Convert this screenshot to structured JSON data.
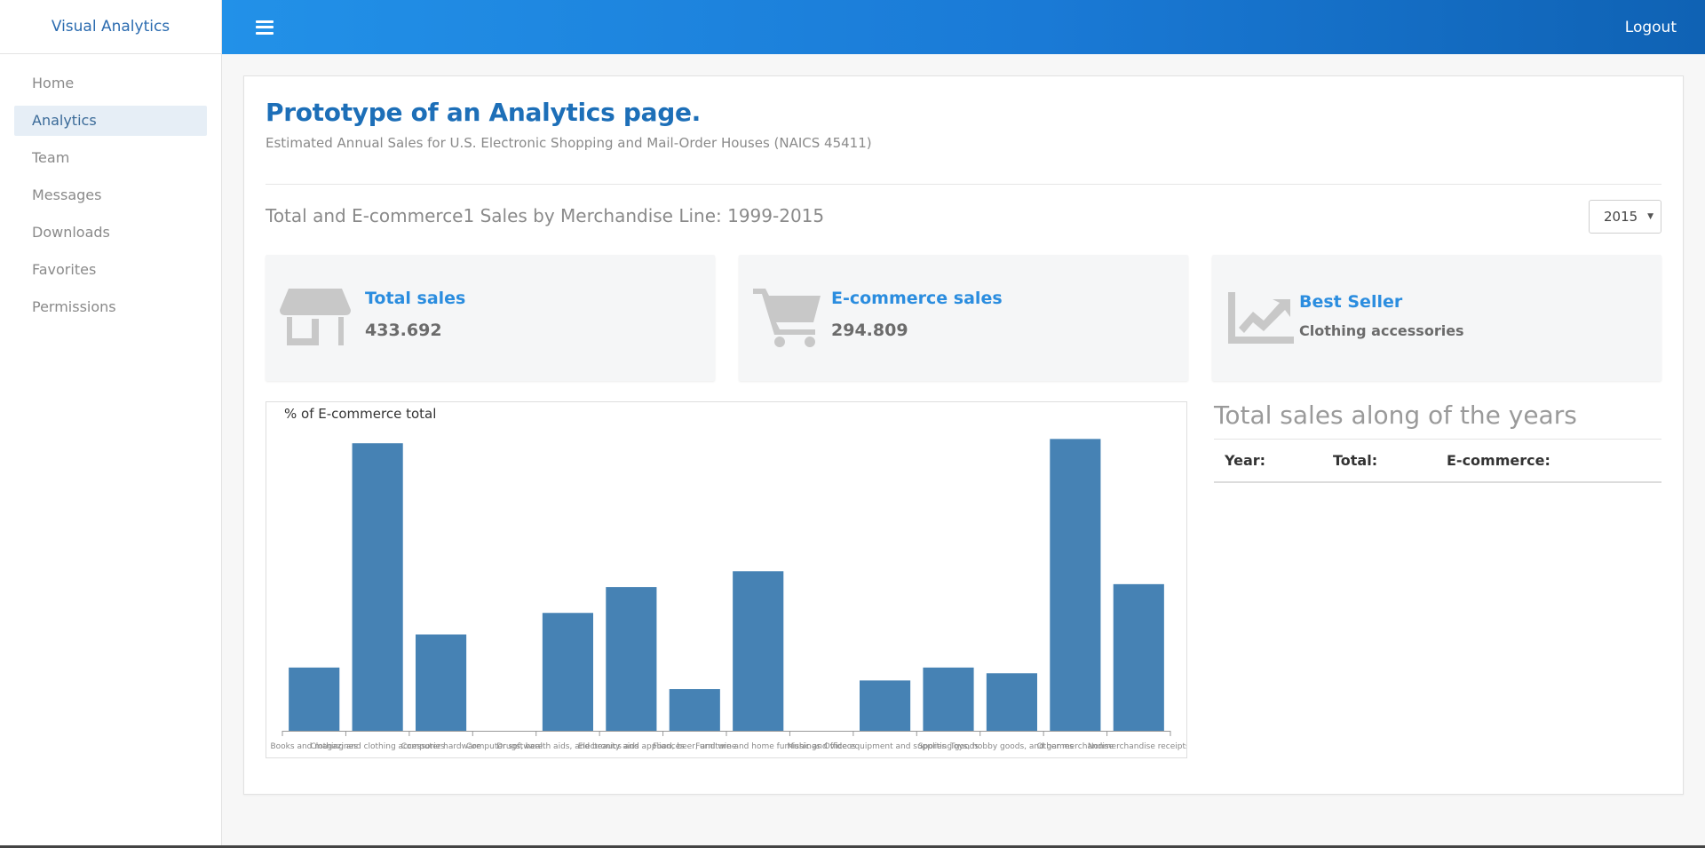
{
  "app": {
    "brand": "Visual Analytics",
    "logout": "Logout"
  },
  "sidebar": {
    "items": [
      {
        "label": "Home"
      },
      {
        "label": "Analytics"
      },
      {
        "label": "Team"
      },
      {
        "label": "Messages"
      },
      {
        "label": "Downloads"
      },
      {
        "label": "Favorites"
      },
      {
        "label": "Permissions"
      }
    ],
    "active": "Analytics"
  },
  "main": {
    "title": "Prototype of an Analytics page.",
    "subtitle": "Estimated Annual Sales for U.S. Electronic Shopping and Mail-Order Houses (NAICS 45411)",
    "section_title": "Total and E-commerce1 Sales by Merchandise Line: 1999-2015",
    "year_select": {
      "value": "2015"
    },
    "stats": [
      {
        "label": "Total sales",
        "value": "433.692",
        "icon": "store-icon"
      },
      {
        "label": "E-commerce sales",
        "value": "294.809",
        "icon": "cart-icon"
      },
      {
        "label": "Best Seller",
        "value": "Clothing accessories",
        "icon": "trend-chart-icon"
      }
    ],
    "right_panel": {
      "title": "Total sales along of the years",
      "columns": [
        "Year:",
        "Total:",
        "E-commerce:"
      ]
    }
  },
  "colors": {
    "accent": "#1d6fb8",
    "bar": "#4682b4",
    "topbar": "#1a7ad6"
  },
  "chart_data": {
    "type": "bar",
    "ylabel": "% of E-commerce total",
    "categories": [
      "Books and magazines",
      "Clothing and clothing accessories",
      "Computer hardware",
      "Computer software",
      "Drugs, health aids, and beauty aids",
      "Electronics and appliances",
      "Food, beer, and wine",
      "Furniture and home furnishings",
      "Music and videos",
      "Office equipment and supplies",
      "Sporting goods",
      "Toys, hobby goods, and games",
      "Other merchandise",
      "Nonmerchandise receipts"
    ],
    "values": [
      22,
      100,
      33.5,
      0,
      41,
      50,
      14.5,
      55.5,
      0,
      17.5,
      22,
      20,
      101.5,
      51
    ],
    "ylim": [
      0,
      105
    ],
    "grid": false
  }
}
